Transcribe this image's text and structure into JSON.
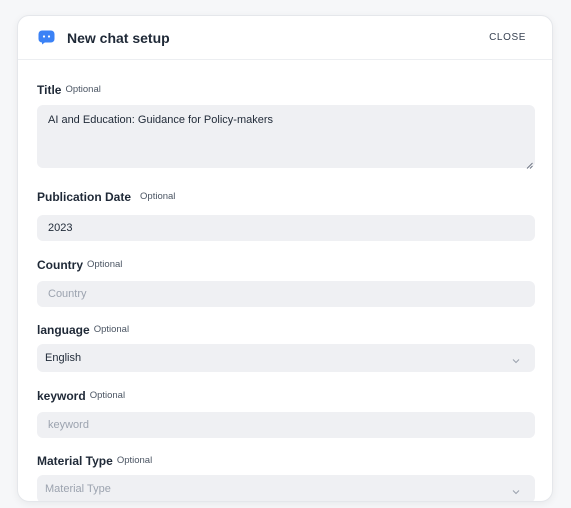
{
  "header": {
    "title": "New chat setup",
    "close_label": "CLOSE",
    "icon": "chat-bubble-icon",
    "icon_color": "#3b82f6"
  },
  "fields": {
    "title": {
      "label": "Title",
      "optional": "Optional",
      "value": "AI and Education: Guidance for Policy-makers"
    },
    "publication_date": {
      "label": "Publication Date",
      "optional": "Optional",
      "value": "2023"
    },
    "country": {
      "label": "Country",
      "optional": "Optional",
      "value": "",
      "placeholder": "Country"
    },
    "language": {
      "label": "language",
      "optional": "Optional",
      "selected": "English"
    },
    "keyword": {
      "label": "keyword",
      "optional": "Optional",
      "value": "",
      "placeholder": "keyword"
    },
    "material_type": {
      "label": "Material Type",
      "optional": "Optional",
      "placeholder": "Material Type"
    }
  }
}
